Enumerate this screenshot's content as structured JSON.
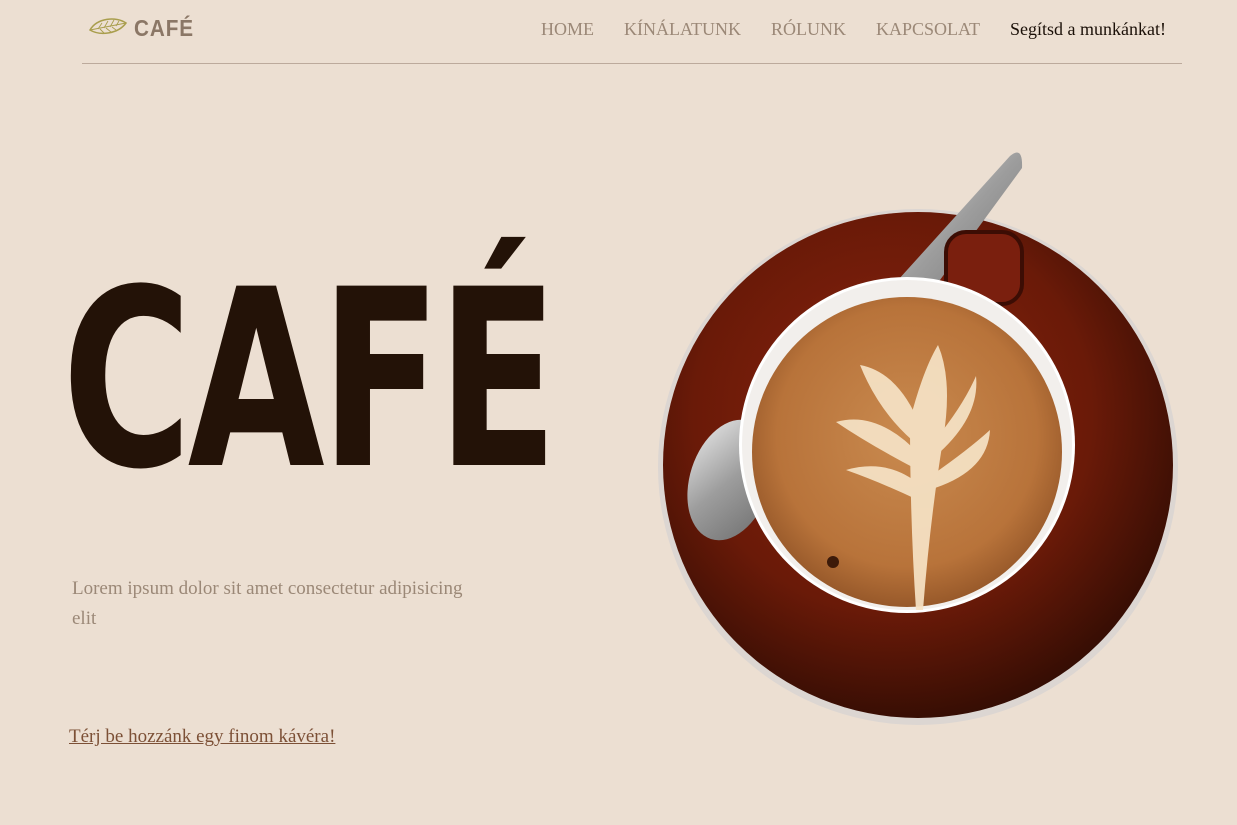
{
  "header": {
    "brand": "CAFÉ",
    "nav": [
      "HOME",
      "KÍNÁLATUNK",
      "RÓLUNK",
      "KAPCSOLAT",
      "Segítsd a munkánkat!"
    ]
  },
  "hero": {
    "title": "CAFÉ",
    "text": "Lorem ipsum dolor sit amet consectetur adipisicing elit",
    "link": "Térj be hozzánk egy finom kávéra!"
  },
  "colors": {
    "background": "#ecdfd2",
    "title": "#231207",
    "nav": "#9b8877",
    "link": "#7c5036"
  },
  "icons": {
    "logo": "leaf-icon",
    "image": "coffee-cup-latte-art"
  }
}
